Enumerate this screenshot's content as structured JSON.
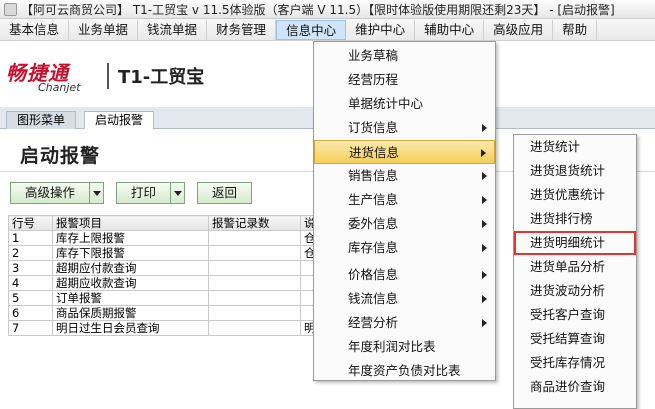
{
  "window": {
    "title": "【阿可云商贸公司】 T1-工贸宝 v 11.5体验版（客户端 V 11.5）【限时体验版使用期限还剩23天】 - [启动报警]"
  },
  "menubar": {
    "items": [
      {
        "label": "基本信息"
      },
      {
        "label": "业务单据"
      },
      {
        "label": "钱流单据"
      },
      {
        "label": "财务管理"
      },
      {
        "label": "信息中心",
        "active": true
      },
      {
        "label": "维护中心"
      },
      {
        "label": "辅助中心"
      },
      {
        "label": "高级应用"
      },
      {
        "label": "帮助"
      }
    ]
  },
  "brand": {
    "logo_cn": "畅捷通",
    "logo_en": "Chanjet",
    "product": "T1-工贸宝"
  },
  "tabs": [
    {
      "label": "图形菜单"
    },
    {
      "label": "启动报警",
      "active": true
    }
  ],
  "page": {
    "title": "启动报警"
  },
  "toolbar": {
    "advanced_label": "高级操作",
    "print_label": "打印",
    "back_label": "返回"
  },
  "grid": {
    "headers": [
      "行号",
      "报警项目",
      "报警记录数",
      "说"
    ],
    "rows": [
      [
        "1",
        "库存上限报警",
        "",
        "仓"
      ],
      [
        "2",
        "库存下限报警",
        "",
        "仓"
      ],
      [
        "3",
        "超期应付款查询",
        "",
        ""
      ],
      [
        "4",
        "超期应收款查询",
        "",
        ""
      ],
      [
        "5",
        "订单报警",
        "",
        ""
      ],
      [
        "6",
        "商品保质期报警",
        "",
        ""
      ],
      [
        "7",
        "明日过生日会员查询",
        "",
        "明"
      ]
    ]
  },
  "menu_info_center": {
    "items": [
      {
        "label": "业务草稿",
        "submenu": false
      },
      {
        "label": "经营历程",
        "submenu": false
      },
      {
        "label": "单据统计中心",
        "submenu": false
      },
      {
        "label": "订货信息",
        "submenu": true
      },
      {
        "label": "进货信息",
        "submenu": true,
        "highlight": true
      },
      {
        "label": "销售信息",
        "submenu": true
      },
      {
        "label": "生产信息",
        "submenu": true
      },
      {
        "label": "委外信息",
        "submenu": true
      },
      {
        "label": "库存信息",
        "submenu": true
      },
      {
        "label": "价格信息",
        "submenu": true
      },
      {
        "label": "钱流信息",
        "submenu": true
      },
      {
        "label": "经营分析",
        "submenu": true
      },
      {
        "label": "年度利润对比表",
        "submenu": false
      },
      {
        "label": "年度资产负债对比表",
        "submenu": false
      }
    ]
  },
  "menu_purchase_info": {
    "items": [
      {
        "label": "进货统计"
      },
      {
        "label": "进货退货统计"
      },
      {
        "label": "进货优惠统计"
      },
      {
        "label": "进货排行榜"
      },
      {
        "label": "进货明细统计",
        "boxed": true
      },
      {
        "label": "进货单品分析"
      },
      {
        "label": "进货波动分析"
      },
      {
        "label": "受托客户查询"
      },
      {
        "label": "受托结算查询"
      },
      {
        "label": "受托库存情况"
      },
      {
        "label": "商品进价查询"
      }
    ]
  }
}
